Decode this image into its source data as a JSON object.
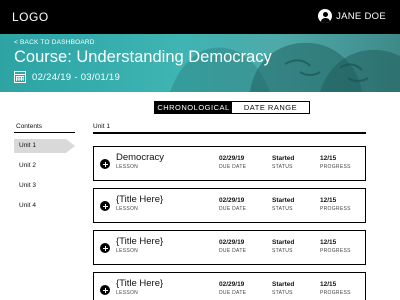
{
  "header": {
    "logo": "LOGO",
    "user_name": "JANE DOE",
    "user_icon": "user-circle-icon"
  },
  "hero": {
    "back_link": "< BACK TO DASHBOARD",
    "course_title": "Course: Understanding Democracy",
    "date_range": "02/24/19 - 03/01/19",
    "date_icon": "calendar-icon",
    "accent_color": "#3fb4b3"
  },
  "view_toggle": {
    "options": [
      "CHRONOLOGICAL",
      "DATE RANGE"
    ],
    "selected": "CHRONOLOGICAL"
  },
  "sidebar": {
    "heading": "Contents",
    "items": [
      {
        "label": "Unit 1",
        "active": true
      },
      {
        "label": "Unit 2",
        "active": false
      },
      {
        "label": "Unit 3",
        "active": false
      },
      {
        "label": "Unit 4",
        "active": false
      }
    ]
  },
  "unit": {
    "heading": "Unit 1",
    "lessons": [
      {
        "title": "Democracy",
        "type": "LESSON",
        "due_date": "02/29/19",
        "due_label": "DUE DATE",
        "status": "Started",
        "status_label": "STATUS",
        "progress": "12/15",
        "progress_label": "PROGRESS"
      },
      {
        "title": "{Title Here}",
        "type": "LESSON",
        "due_date": "02/29/19",
        "due_label": "DUE DATE",
        "status": "Started",
        "status_label": "STATUS",
        "progress": "12/15",
        "progress_label": "PROGRESS"
      },
      {
        "title": "{Title Here}",
        "type": "LESSON",
        "due_date": "02/29/19",
        "due_label": "DUE DATE",
        "status": "Started",
        "status_label": "STATUS",
        "progress": "12/15",
        "progress_label": "PROGRESS"
      },
      {
        "title": "{Title Here}",
        "type": "LESSON",
        "due_date": "02/29/19",
        "due_label": "DUE DATE",
        "status": "Started",
        "status_label": "STATUS",
        "progress": "12/15",
        "progress_label": "PROGRESS"
      }
    ]
  }
}
